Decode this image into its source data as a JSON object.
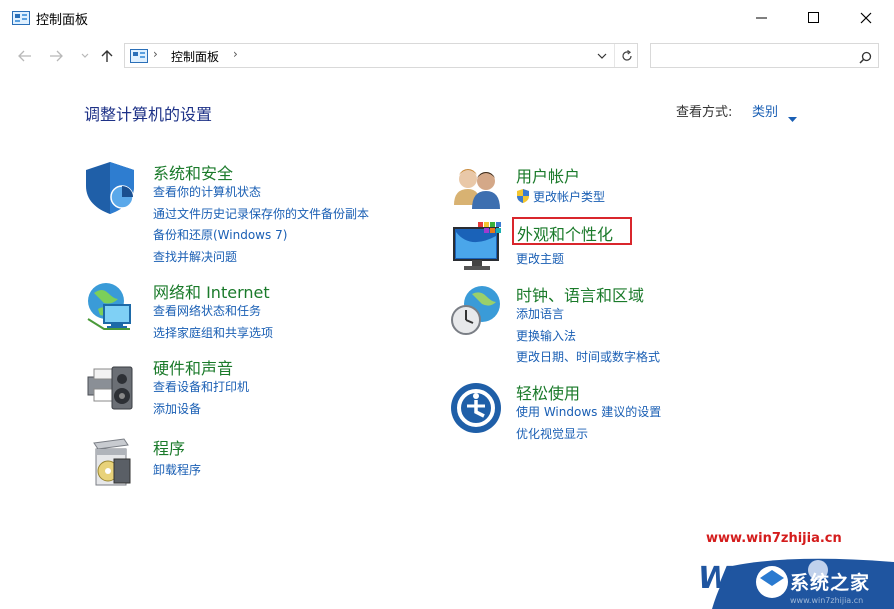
{
  "window": {
    "title": "控制面板"
  },
  "address_bar": {
    "path": [
      "控制面板"
    ],
    "search_placeholder": ""
  },
  "header": {
    "page_title": "调整计算机的设置",
    "view_by_label": "查看方式:",
    "view_by_value": "类别"
  },
  "categories_left": [
    {
      "icon": "shield-icon",
      "title": "系统和安全",
      "links": [
        "查看你的计算机状态",
        "通过文件历史记录保存你的文件备份副本",
        "备份和还原(Windows 7)",
        "查找并解决问题"
      ]
    },
    {
      "icon": "network-globe-icon",
      "title": "网络和 Internet",
      "links": [
        "查看网络状态和任务",
        "选择家庭组和共享选项"
      ]
    },
    {
      "icon": "printer-speaker-icon",
      "title": "硬件和声音",
      "links": [
        "查看设备和打印机",
        "添加设备"
      ]
    },
    {
      "icon": "programs-icon",
      "title": "程序",
      "links": [
        "卸载程序"
      ]
    }
  ],
  "categories_right": [
    {
      "icon": "users-icon",
      "title": "用户帐户",
      "links": [
        "更改帐户类型"
      ]
    },
    {
      "icon": "monitor-palette-icon",
      "title": "外观和个性化",
      "links": [
        "更改主题"
      ]
    },
    {
      "icon": "clock-globe-icon",
      "title": "时钟、语言和区域",
      "links": [
        "添加语言",
        "更换输入法",
        "更改日期、时间或数字格式"
      ]
    },
    {
      "icon": "ease-of-access-icon",
      "title": "轻松使用",
      "links": [
        "使用 Windows 建议的设置",
        "优化视觉显示"
      ]
    }
  ],
  "watermark": {
    "site": "www.win7zhijia.cn",
    "brand": "系统之家",
    "url": "www.win7zhijia.cn"
  },
  "colors": {
    "category_title": "#1a7a2a",
    "link": "#1a5fb4",
    "page_title": "#1e3287",
    "highlight": "#d9262c"
  }
}
